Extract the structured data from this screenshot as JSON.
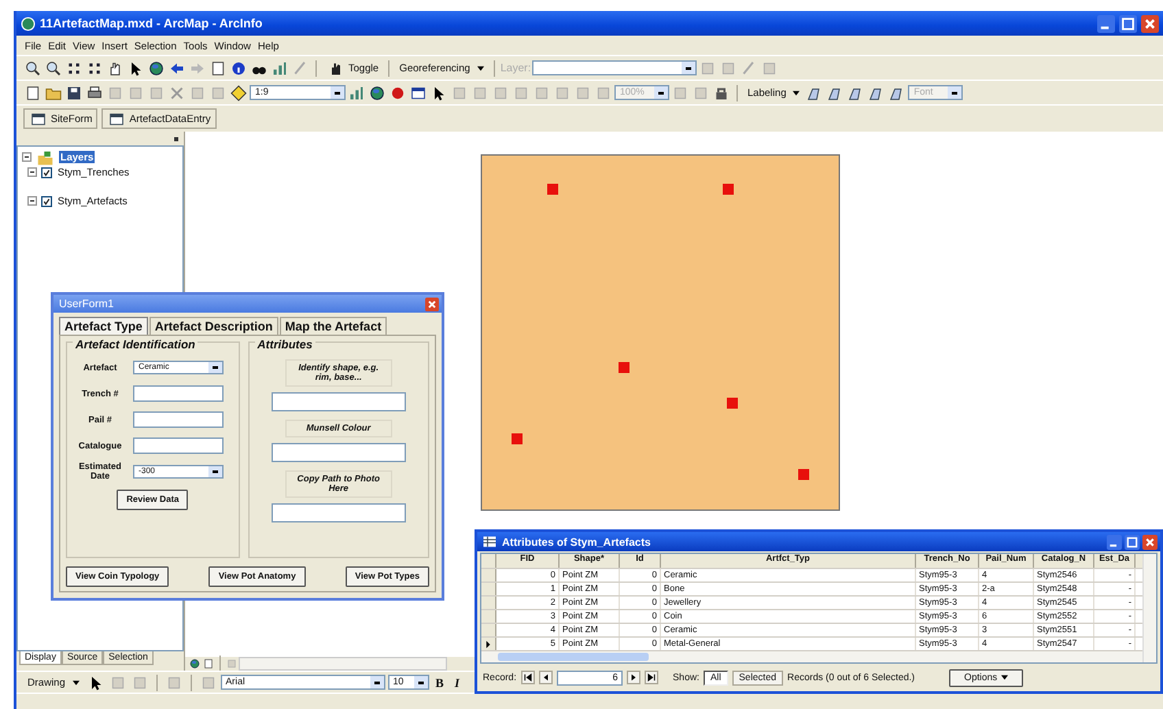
{
  "window": {
    "title": "11ArtefactMap.mxd - ArcMap - ArcInfo"
  },
  "menu": [
    "File",
    "Edit",
    "View",
    "Insert",
    "Selection",
    "Tools",
    "Window",
    "Help"
  ],
  "toolbar_1": {
    "toggle": "Toggle",
    "georeferencing": "Georeferencing",
    "layer_label": "Layer:"
  },
  "toolbar_2": {
    "scale": "1:9",
    "zoom": "100%",
    "labeling": "Labeling",
    "font": "Font"
  },
  "toolbar_3": [
    "SiteForm",
    "ArtefactDataEntry"
  ],
  "toc": {
    "root": {
      "label": "Layers",
      "selected": true,
      "expanded": true,
      "children": [
        {
          "label": "Stym_Trenches",
          "checked": true,
          "expanded": true
        },
        {
          "label": "Stym_Artefacts",
          "checked": true,
          "expanded": true
        }
      ]
    },
    "tabs": [
      {
        "label": "Display",
        "selected": true
      },
      {
        "label": "Source",
        "selected": false
      },
      {
        "label": "Selection",
        "selected": false
      }
    ]
  },
  "user_form": {
    "title": "UserForm1",
    "tabs": [
      {
        "label": "Artefact Type",
        "selected": true
      },
      {
        "label": "Artefact Description",
        "selected": false
      },
      {
        "label": "Map the Artefact",
        "selected": false
      }
    ],
    "identification": {
      "title": "Artefact Identification",
      "fields": [
        {
          "kind": "dropdown",
          "label": "Artefact",
          "value": "Ceramic"
        },
        {
          "kind": "text",
          "label": "Trench #"
        },
        {
          "kind": "text",
          "label": "Pail #"
        },
        {
          "kind": "text",
          "label": "Catalogue"
        },
        {
          "kind": "dropdown",
          "label": "Estimated Date",
          "value": "-300"
        }
      ],
      "button": "Review Data"
    },
    "attributes": {
      "title": "Attributes",
      "fields": [
        {
          "label": "Identify shape, e.g. rim, base..."
        },
        {
          "label": "Munsell Colour"
        },
        {
          "label": "Copy Path to Photo Here"
        }
      ]
    },
    "buttons": [
      "View Coin Typology",
      "View Pot Anatomy",
      "View Pot Types"
    ]
  },
  "attribute_table": {
    "title": "Attributes of Stym_Artefacts",
    "columns": [
      "FID",
      "Shape*",
      "Id",
      "Artfct_Typ",
      "Trench_No",
      "Pail_Num",
      "Catalog_N",
      "Est_Da"
    ],
    "rows": [
      {
        "current": false,
        "cells": [
          "0",
          "Point ZM",
          "0",
          "Ceramic",
          "Stym95-3",
          "4",
          "Stym2546",
          "-"
        ]
      },
      {
        "current": false,
        "cells": [
          "1",
          "Point ZM",
          "0",
          "Bone",
          "Stym95-3",
          "2-a",
          "Stym2548",
          "-"
        ]
      },
      {
        "current": false,
        "cells": [
          "2",
          "Point ZM",
          "0",
          "Jewellery",
          "Stym95-3",
          "4",
          "Stym2545",
          "-"
        ]
      },
      {
        "current": false,
        "cells": [
          "3",
          "Point ZM",
          "0",
          "Coin",
          "Stym95-3",
          "6",
          "Stym2552",
          "-"
        ]
      },
      {
        "current": false,
        "cells": [
          "4",
          "Point ZM",
          "0",
          "Ceramic",
          "Stym95-3",
          "3",
          "Stym2551",
          "-"
        ]
      },
      {
        "current": true,
        "cells": [
          "5",
          "Point ZM",
          "0",
          "Metal-General",
          "Stym95-3",
          "4",
          "Stym2547",
          "-"
        ]
      }
    ],
    "footer": {
      "record_label": "Record:",
      "record": "6",
      "show_label": "Show:",
      "show_buttons": [
        {
          "label": "All",
          "selected": true
        },
        {
          "label": "Selected",
          "selected": false
        }
      ],
      "records": "Records (0 out of 6 Selected.)",
      "options": "Options"
    }
  },
  "drawing_toolbar": {
    "drawing": "Drawing",
    "font": "Arial",
    "size": "10",
    "bold": "B",
    "italic": "I"
  }
}
